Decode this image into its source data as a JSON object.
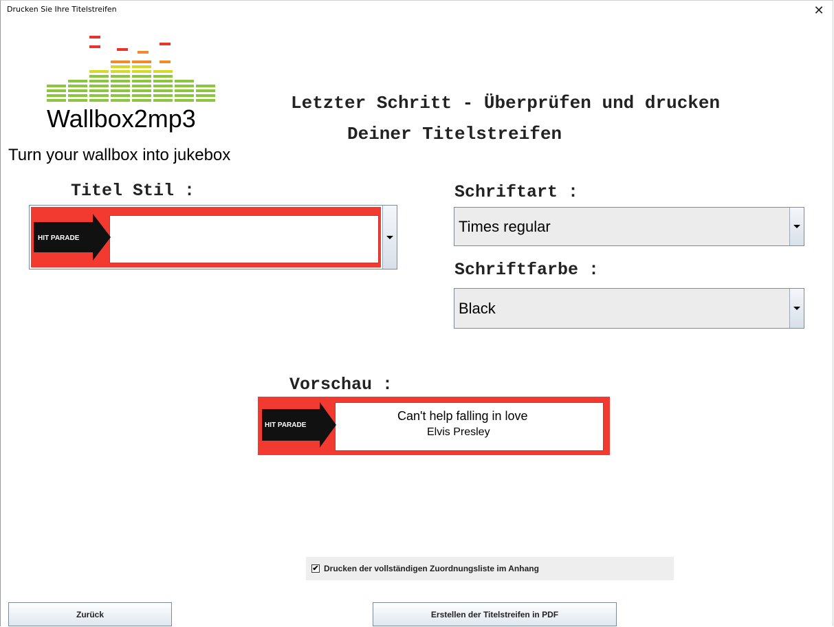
{
  "window": {
    "title": "Drucken Sie Ihre Titelstreifen",
    "close_glyph": "✕"
  },
  "logo": {
    "name": "Wallbox2mp3",
    "tagline": "Turn your wallbox into jukebox"
  },
  "heading": {
    "line1": "Letzter Schritt - Überprüfen und drucken",
    "line2": "Deiner Titelstreifen"
  },
  "title_style": {
    "label": "Titel Stil :",
    "strip_badge": "HIT PARADE"
  },
  "font": {
    "label": "Schriftart :",
    "selected": "Times regular"
  },
  "font_color": {
    "label": "Schriftfarbe :",
    "selected": "Black"
  },
  "preview": {
    "label": "Vorschau :",
    "badge": "HIT PARADE",
    "song_title": "Can't help falling in love",
    "artist": "Elvis Presley"
  },
  "print_list": {
    "checked": true,
    "check_glyph": "✔",
    "label": "Drucken der vollständigen Zuordnungsliste im Anhang"
  },
  "buttons": {
    "back": "Zurück",
    "create_pdf": "Erstellen der Titelstreifen in PDF"
  },
  "colors": {
    "strip_red": "#f23a30",
    "logo_red": "#e8352b",
    "logo_orange": "#f08a2a",
    "logo_yellow": "#d8d82a",
    "logo_green": "#8cc63f"
  }
}
